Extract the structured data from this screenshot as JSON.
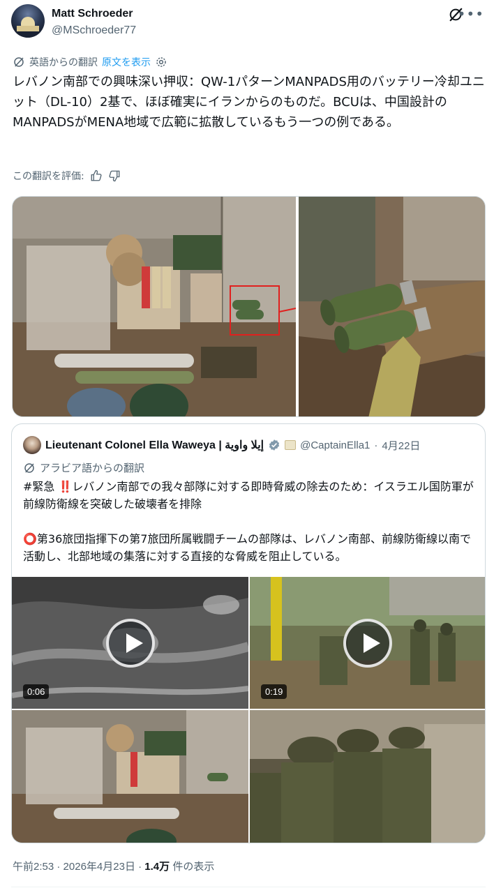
{
  "author": {
    "name": "Matt Schroeder",
    "handle": "@MSchroeder77"
  },
  "translation_bar": {
    "label": "英語からの翻訳",
    "show_original": "原文を表示"
  },
  "tweet_text": "レバノン南部での興味深い押収：QW-1パターンMANPADS用のバッテリー冷却ユニット（DL-10）2基で、ほぼ確実にイランからのものだ。BCUは、中国設計のMANPADSがMENA地域で広範に拡散しているもう一つの例である。",
  "rate_translation": "この翻訳を評価:",
  "quote": {
    "name": "Lieutenant Colonel Ella Waweya | إيلا واوية",
    "handle": "@CaptainElla1",
    "date": "4月22日",
    "translation_label": "アラビア語からの翻訳",
    "line1": "#緊急 ‼️レバノン南部での我々部隊に対する即時脅威の除去のため：イスラエル国防軍が前線防衛線を突破した破壊者を排除",
    "line2": "⭕第36旅団指揮下の第7旅団所属戦闘チームの部隊は、レバノン南部、前線防衛線以南で活動し、北部地域の集落に対する直接的な脅威を阻止している。",
    "videos": [
      {
        "duration": "0:06"
      },
      {
        "duration": "0:19"
      }
    ]
  },
  "footer": {
    "time": "午前2:53",
    "sep": "·",
    "date": "2026年4月23日",
    "views_count": "1.4万",
    "views_label": "件の表示"
  },
  "icons": [
    "grok-icon",
    "more-icon",
    "translate-icon",
    "gear-icon",
    "thumbs-up-icon",
    "thumbs-down-icon",
    "verified-icon",
    "play-icon"
  ],
  "colors": {
    "link": "#1d9bf0",
    "secondary_text": "#536471",
    "primary_text": "#0f1419",
    "border": "#cfd9de",
    "verified_badge": "#829aab"
  }
}
